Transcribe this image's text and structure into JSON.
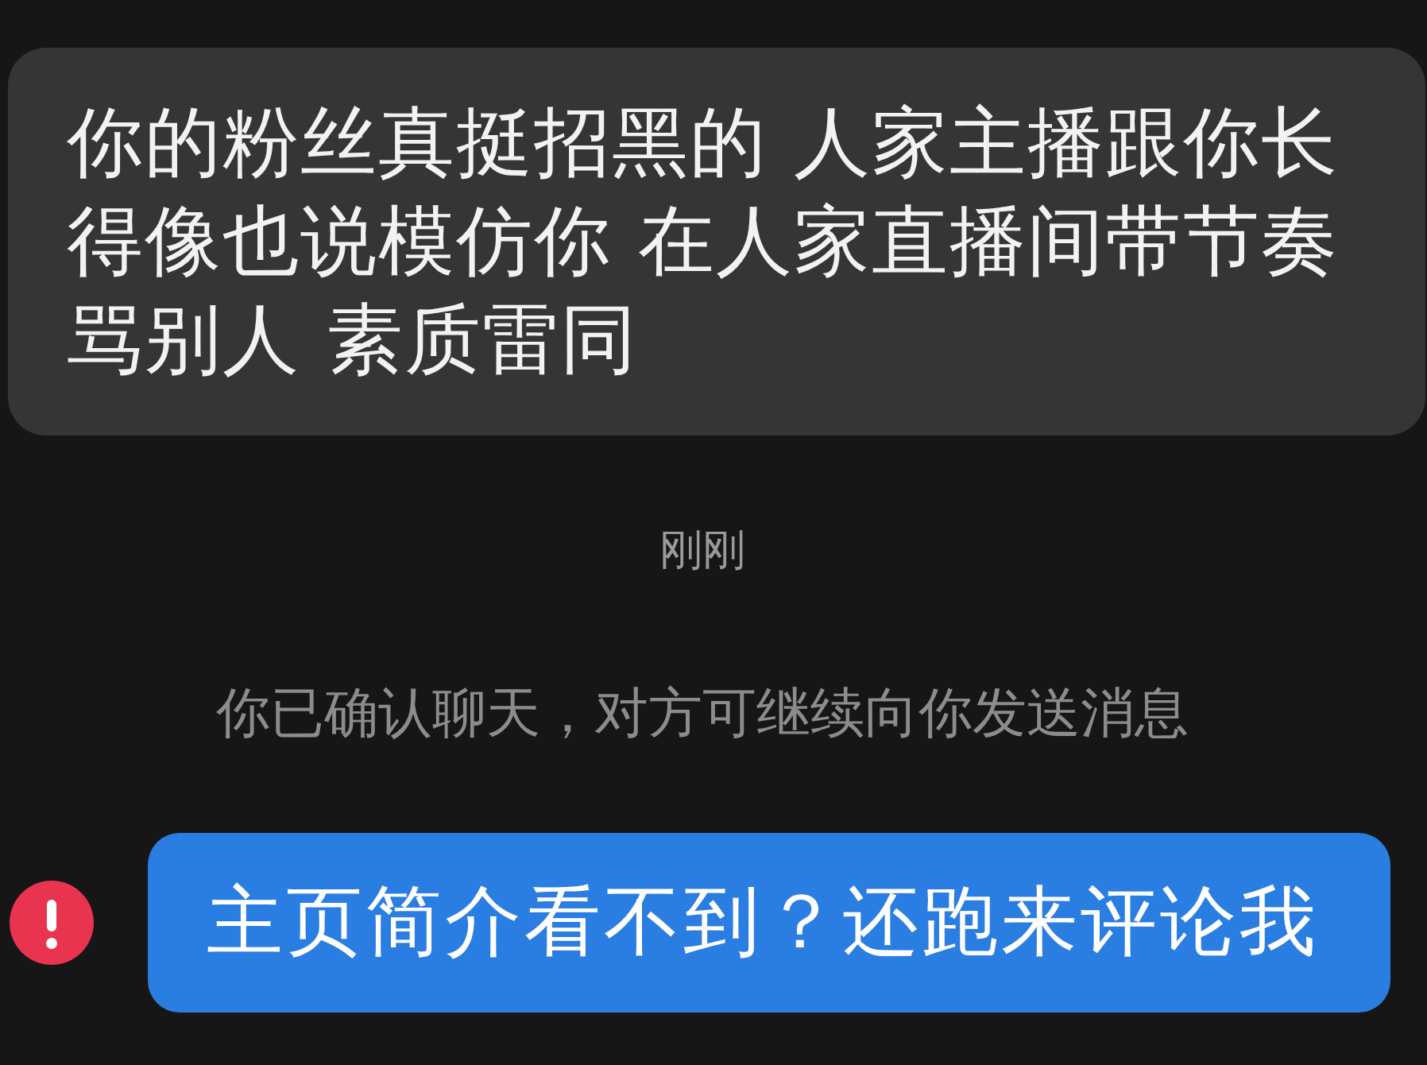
{
  "messages": [
    {
      "kind": "incoming",
      "text": "你的粉丝真挺招黑的 人家主播跟你长得像也说模仿你 在人家直播间带节奏骂别人 素质雷同"
    },
    {
      "kind": "time",
      "text": "刚刚"
    },
    {
      "kind": "notice",
      "text": "你已确认聊天，对方可继续向你发送消息"
    },
    {
      "kind": "outgoing",
      "text": "主页简介看不到？还跑来评论我",
      "failed": true
    }
  ]
}
